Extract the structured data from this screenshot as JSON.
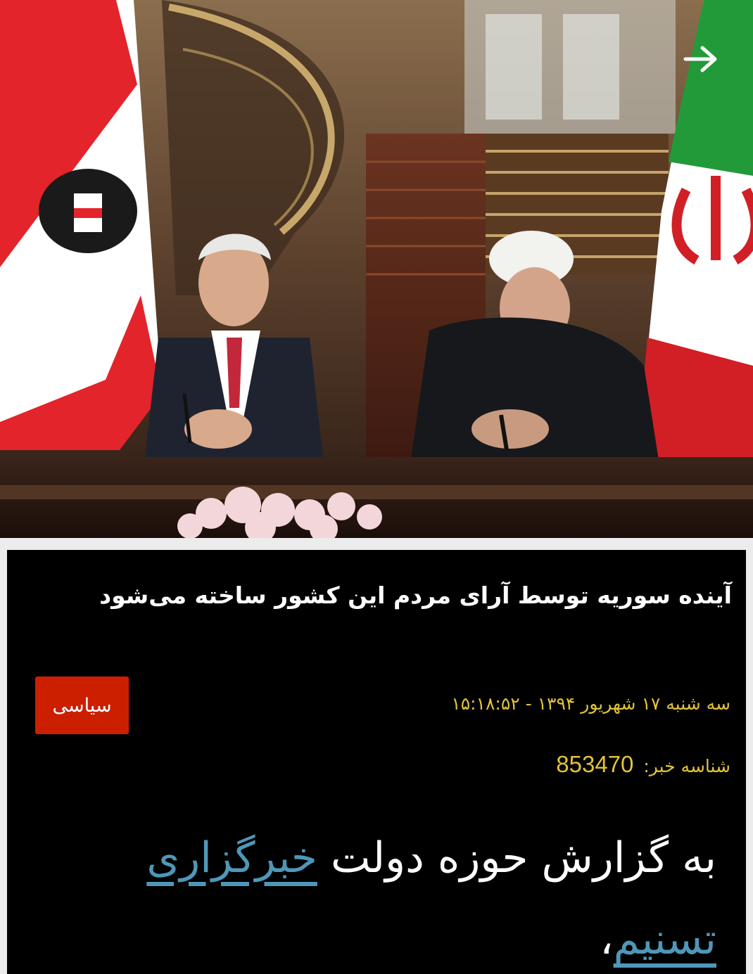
{
  "hero": {
    "image_icon": "press-conference-photo",
    "back_icon": "arrow-right-icon"
  },
  "article": {
    "title": "آینده سوریه توسط آرای مردم این کشور ساخته می‌شود",
    "category": "سیاسی",
    "date": "سه شنبه ۱۷ شهریور ۱۳۹۴ - ۱۵:۱۸:۵۲",
    "id_label": "شناسه خبر:",
    "id_value": "853470",
    "body_lead": "به گزارش حوزه دولت",
    "body_link": "خبرگزاری تسنیم",
    "body_comma": "،"
  },
  "colors": {
    "card_bg": "#000000",
    "category_bg": "#cc1f00",
    "meta_text": "#e1c33a",
    "link": "#4f97b8"
  }
}
